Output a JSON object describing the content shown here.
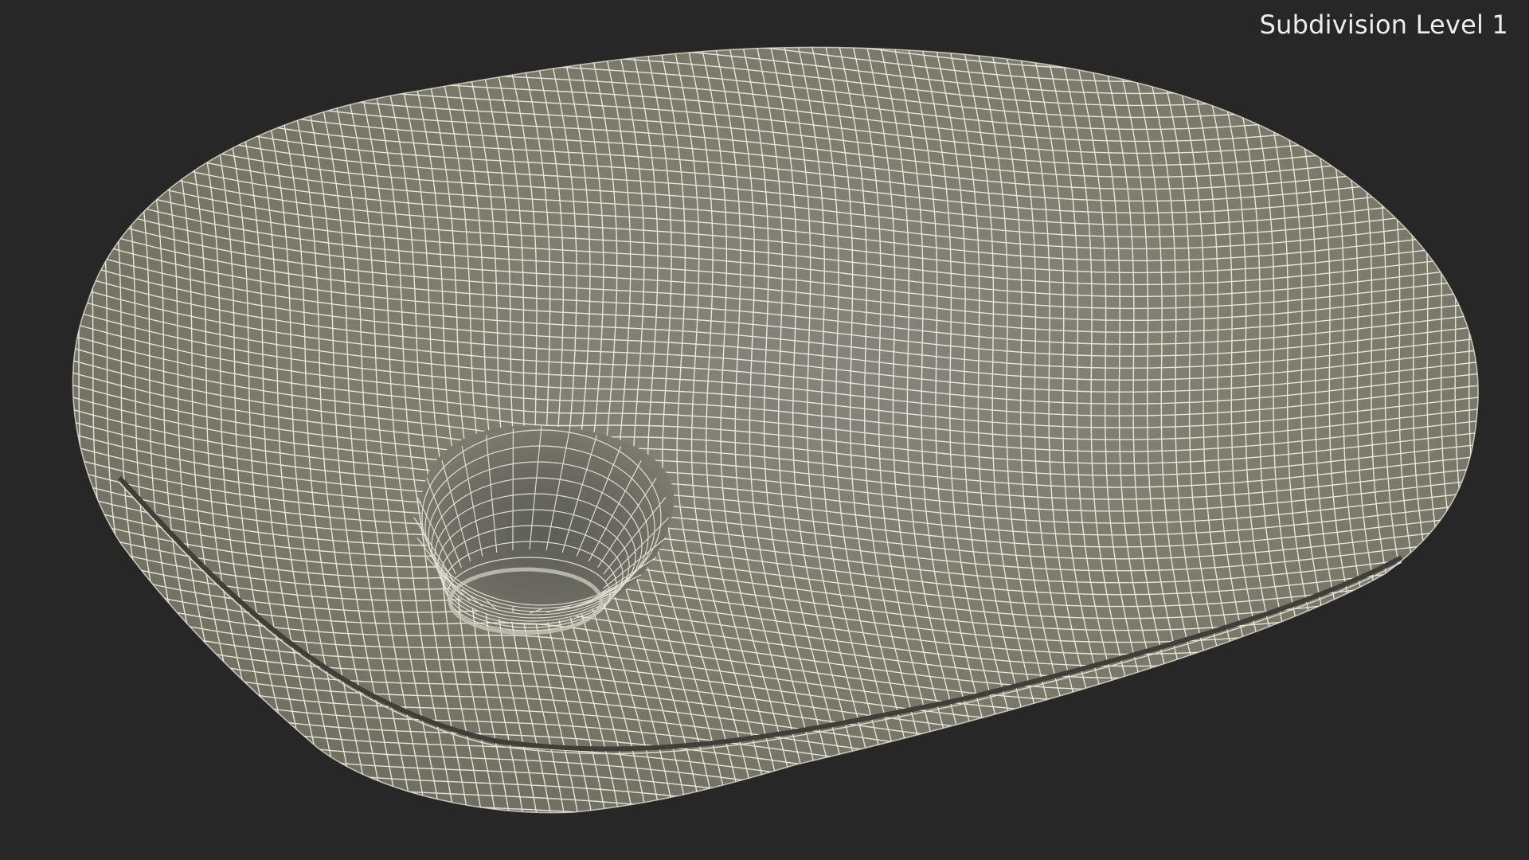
{
  "viewport": {
    "label": "Subdivision Level 1",
    "background_color": "#272727",
    "mesh_surface_color": "#7e7d6f",
    "mesh_shadow_color": "#4f5048",
    "wireframe_color": "#f2f1e4"
  }
}
